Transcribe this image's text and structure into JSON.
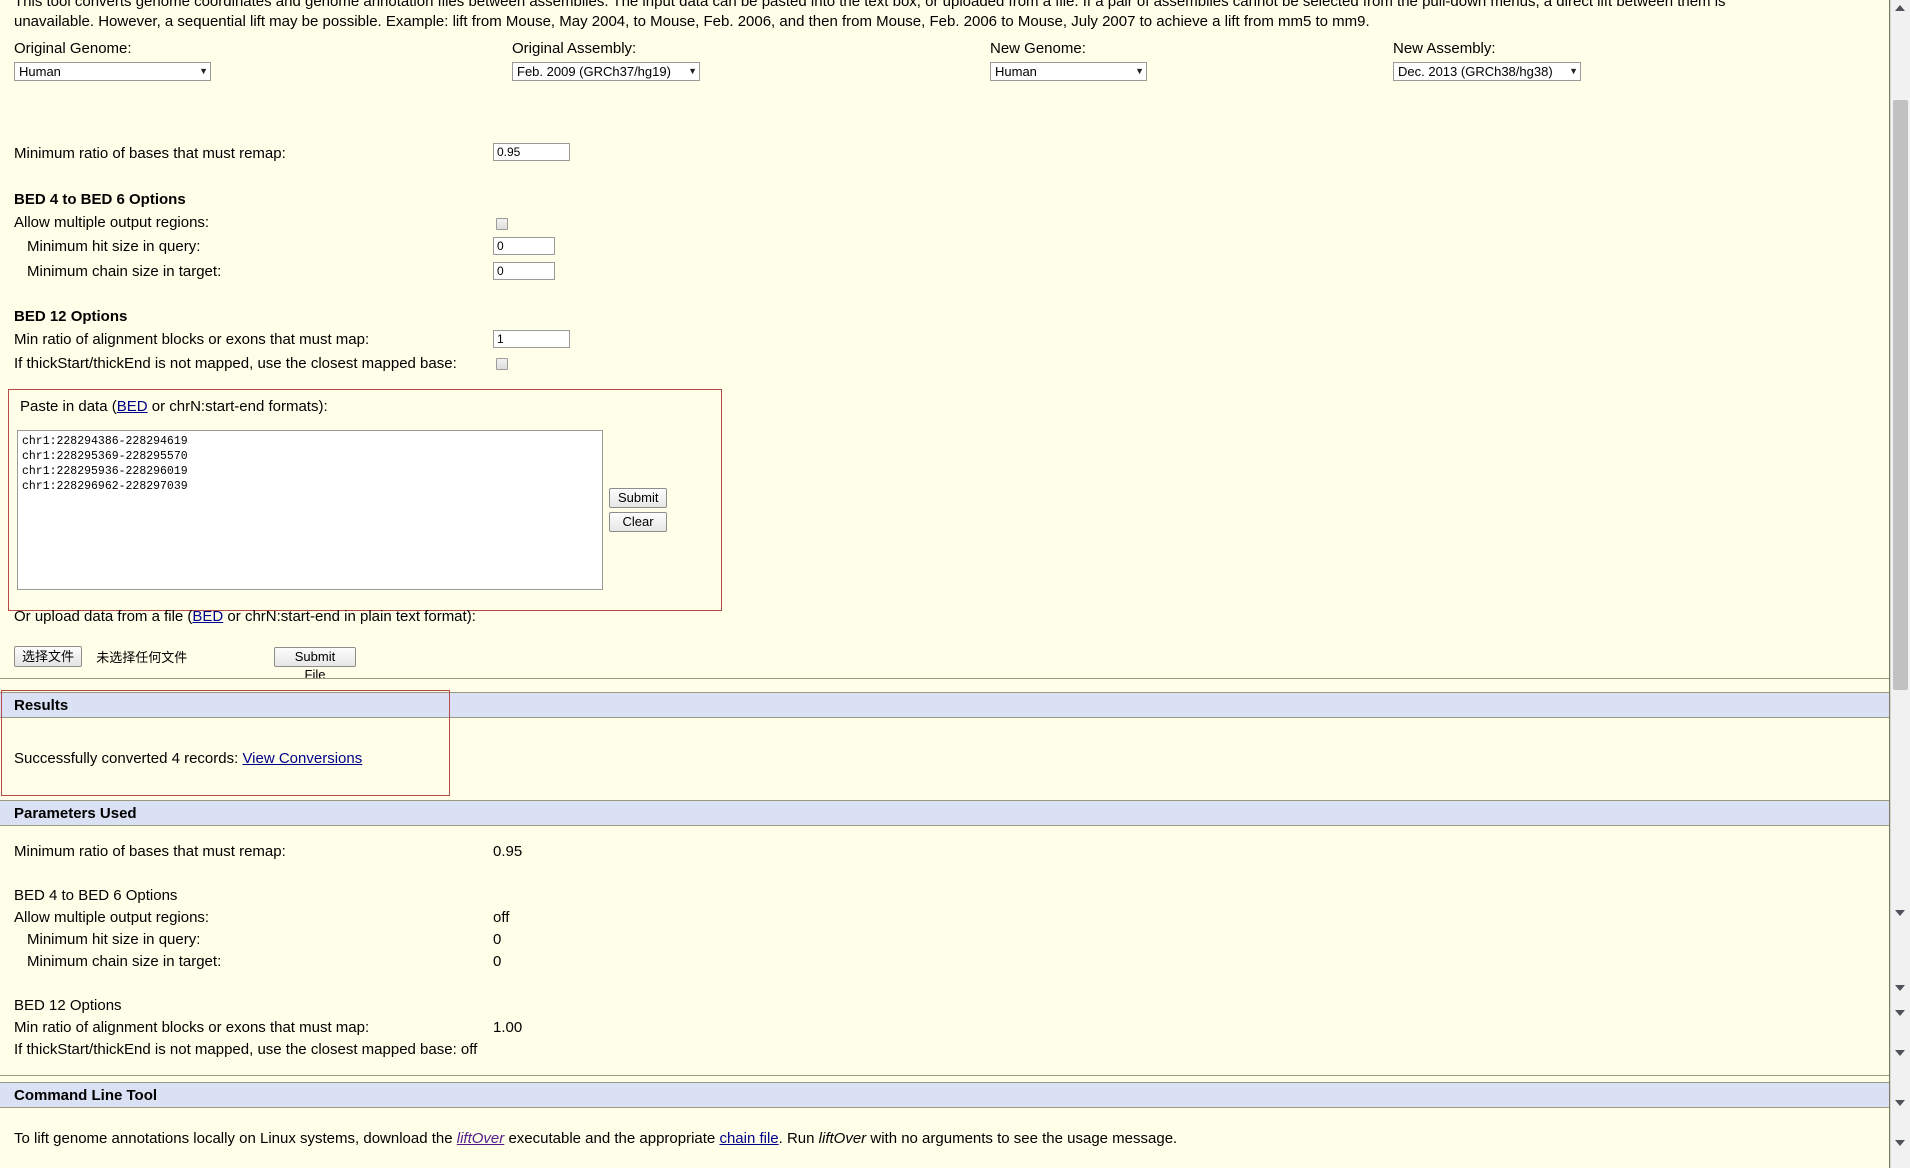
{
  "intro": {
    "line1": "This tool converts genome coordinates and genome annotation files between assemblies.  The input data can be pasted into the text box, or uploaded from a file.  If a pair of assemblies cannot be selected from the pull-down menus, a direct lift between them is",
    "line2": "unavailable.  However, a sequential lift may be possible.  Example: lift from Mouse, May 2004, to Mouse, Feb. 2006, and then from Mouse, Feb. 2006 to Mouse, July 2007 to achieve a lift from mm5 to mm9."
  },
  "selectors": {
    "original_genome": {
      "label": "Original Genome:",
      "value": "Human"
    },
    "original_assembly": {
      "label": "Original Assembly:",
      "value": "Feb. 2009 (GRCh37/hg19)"
    },
    "new_genome": {
      "label": "New Genome:",
      "value": "Human"
    },
    "new_assembly": {
      "label": "New Assembly:",
      "value": "Dec. 2013 (GRCh38/hg38)"
    }
  },
  "form": {
    "min_ratio_label": "Minimum ratio of bases that must remap:",
    "min_ratio_value": "0.95",
    "bed4_heading": "BED 4 to BED 6 Options",
    "allow_multiple_label": "Allow multiple output regions:",
    "min_hit_label": "Minimum hit size in query:",
    "min_hit_value": "0",
    "min_chain_label": "Minimum chain size in target:",
    "min_chain_value": "0",
    "bed12_heading": "BED 12 Options",
    "min_ratio_blocks_label": "Min ratio of alignment blocks or exons that must map:",
    "min_ratio_blocks_value": "1",
    "thickstart_label": "If thickStart/thickEnd is not mapped, use the closest mapped base:"
  },
  "paste": {
    "label_pre": "Paste in data (",
    "label_link": "BED",
    "label_post": " or chrN:start-end formats):",
    "textarea_value": "chr1:228294386-228294619\nchr1:228295369-228295570\nchr1:228295936-228296019\nchr1:228296962-228297039",
    "submit_label": "Submit",
    "clear_label": "Clear"
  },
  "upload": {
    "text_pre": "Or upload data from a file (",
    "text_link": "BED",
    "text_post": " or chrN:start-end in plain text format):",
    "choose_file_label": "选择文件",
    "no_file_label": "未选择任何文件",
    "submit_file_label": "Submit File"
  },
  "results": {
    "heading": "Results",
    "message_pre": "Successfully converted 4 records: ",
    "link_label": "View Conversions",
    "record_count": "4"
  },
  "parameters": {
    "heading": "Parameters Used",
    "rows": [
      {
        "label": "Minimum ratio of bases that must remap:",
        "value": "0.95"
      },
      {
        "label": "BED 4 to BED 6 Options",
        "value": ""
      },
      {
        "label": "Allow multiple output regions:",
        "value": "off"
      },
      {
        "label": "Minimum hit size in query:",
        "value": "0"
      },
      {
        "label": "Minimum chain size in target:",
        "value": "0"
      },
      {
        "label": "BED 12 Options",
        "value": ""
      },
      {
        "label": "Min ratio of alignment blocks or exons that must map:",
        "value": "1.00"
      },
      {
        "label": "If thickStart/thickEnd is not mapped, use the closest mapped base: off",
        "value": ""
      }
    ]
  },
  "command_line": {
    "heading": "Command Line Tool",
    "text_1": "To lift genome annotations locally on Linux systems, download the ",
    "link_liftover": "liftOver",
    "text_2": " executable and the appropriate ",
    "link_chain": "chain file",
    "text_3": ". Run ",
    "italic_liftover": "liftOver",
    "text_4": " with no arguments to see the usage message."
  },
  "colors": {
    "page_background": "#fffee8",
    "section_bar": "#dbe1f4",
    "highlight_border": "#b34a46",
    "link": "#00008b"
  }
}
